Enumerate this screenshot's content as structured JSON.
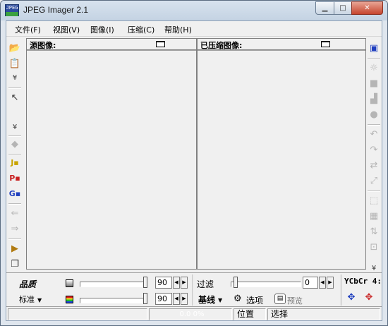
{
  "window": {
    "title": "JPEG Imager 2.1",
    "icon_text": "JPEG",
    "controls": {
      "minimize": "▁",
      "maximize": "□",
      "close": "✕"
    }
  },
  "menu": {
    "items": [
      "文件(F)",
      "视图(V)",
      "图像(I)",
      "压缩(C)",
      "帮助(H)"
    ]
  },
  "panels": {
    "source_title": "源图像:",
    "compressed_title": "已压缩图像:"
  },
  "left_toolbar": {
    "icons": [
      "open-folder-icon",
      "paste-icon",
      "chevron-down-icon",
      "pointer-icon",
      "chevron-down-icon",
      "stamp-icon",
      "j-format-icon",
      "p-format-icon",
      "g-format-icon",
      "import-icon",
      "export-icon",
      "send-icon",
      "copy-stack-icon"
    ]
  },
  "right_toolbar": {
    "icons": [
      "window-icon",
      "brightness-icon",
      "contrast-icon",
      "histogram-icon",
      "circle-icon",
      "rotate-left-icon",
      "rotate-right-icon",
      "flip-icon",
      "resize-icon",
      "crop-icon",
      "grid-icon",
      "adjust-icon",
      "chevron-down-icon"
    ]
  },
  "quality": {
    "label": "品质",
    "mode_label": "标准",
    "value_top": "90",
    "value_bottom": "90",
    "level_top": 0.9,
    "level_bottom": 0.9
  },
  "filter": {
    "label": "过滤",
    "value": "0",
    "level": 0.0
  },
  "encoding": {
    "baseline_label": "基线",
    "options_label": "选项",
    "preview_label": "预览",
    "ycbcr_label": "YCbCr 4:"
  },
  "statusbar": {
    "cell1": "",
    "cell2": "0.0 0%",
    "cell3": "位置",
    "cell4": "选择"
  }
}
